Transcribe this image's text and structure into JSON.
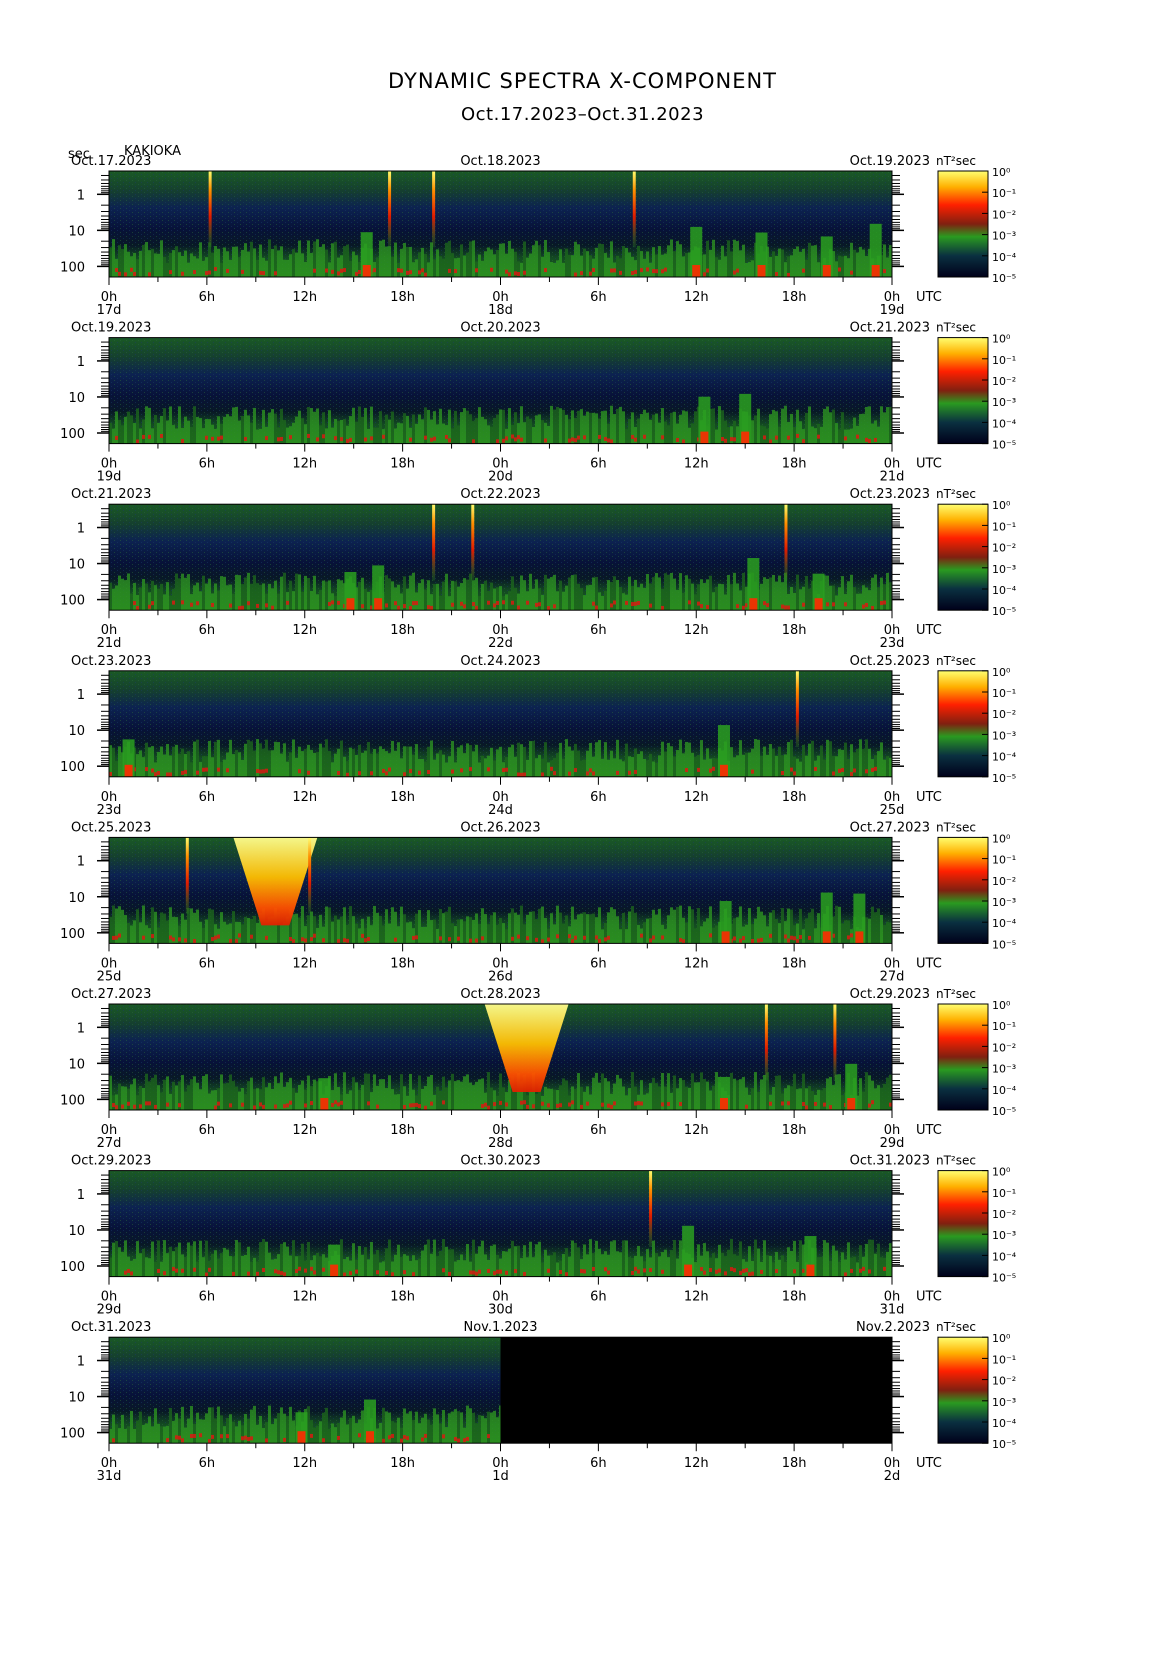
{
  "title": "DYNAMIC SPECTRA X-COMPONENT",
  "subtitle": "Oct.17.2023–Oct.31.2023",
  "station": "KAKIOKA",
  "y_unit": "sec",
  "colorbar_unit": "nT²sec",
  "utc_label": "UTC",
  "colors": {
    "background": "#ffffff",
    "no_data": "#000000"
  },
  "chart_data": {
    "type": "heatmap",
    "ylabel": "sec",
    "y_ticks": [
      "1",
      "10",
      "100"
    ],
    "x_ticks": [
      "0h",
      "6h",
      "12h",
      "18h",
      "0h",
      "6h",
      "12h",
      "18h",
      "0h"
    ],
    "colorbar_ticks": [
      "10⁰",
      "10⁻¹",
      "10⁻²",
      "10⁻³",
      "10⁻⁴",
      "10⁻⁵"
    ],
    "colorbar_unit": "nT²sec",
    "colorscale": [
      "#000010",
      "#0a1a4a",
      "#1a5a2a",
      "#2aa020",
      "#e01010",
      "#ff8000",
      "#ffff60"
    ],
    "panels": [
      {
        "date_left": "Oct.17.2023",
        "date_mid": "Oct.18.2023",
        "date_right": "Oct.19.2023",
        "day_labels": [
          "17d",
          "18d",
          "19d"
        ],
        "spikes_hours": [
          6.2,
          17.2,
          19.9,
          32.2
        ],
        "storm_hours": [],
        "bursts_hours": [
          15.8,
          36,
          40,
          44,
          47
        ],
        "data_end_hour": 48
      },
      {
        "date_left": "Oct.19.2023",
        "date_mid": "Oct.20.2023",
        "date_right": "Oct.21.2023",
        "day_labels": [
          "19d",
          "20d",
          "21d"
        ],
        "spikes_hours": [],
        "storm_hours": [],
        "bursts_hours": [
          36.5,
          39
        ],
        "data_end_hour": 48
      },
      {
        "date_left": "Oct.21.2023",
        "date_mid": "Oct.22.2023",
        "date_right": "Oct.23.2023",
        "day_labels": [
          "21d",
          "22d",
          "23d"
        ],
        "spikes_hours": [
          19.9,
          22.3,
          41.5
        ],
        "storm_hours": [],
        "bursts_hours": [
          14.8,
          16.5,
          39.5,
          43.5
        ],
        "data_end_hour": 48
      },
      {
        "date_left": "Oct.23.2023",
        "date_mid": "Oct.24.2023",
        "date_right": "Oct.25.2023",
        "day_labels": [
          "23d",
          "24d",
          "25d"
        ],
        "spikes_hours": [
          42.2
        ],
        "storm_hours": [],
        "bursts_hours": [
          1.2,
          37.7
        ],
        "data_end_hour": 48
      },
      {
        "date_left": "Oct.25.2023",
        "date_mid": "Oct.26.2023",
        "date_right": "Oct.27.2023",
        "day_labels": [
          "25d",
          "26d",
          "27d"
        ],
        "spikes_hours": [
          4.8,
          12.3
        ],
        "storm_hours": [
          10.2
        ],
        "bursts_hours": [
          37.8,
          44,
          46
        ],
        "data_end_hour": 48
      },
      {
        "date_left": "Oct.27.2023",
        "date_mid": "Oct.28.2023",
        "date_right": "Oct.29.2023",
        "day_labels": [
          "27d",
          "28d",
          "29d"
        ],
        "spikes_hours": [
          40.3,
          44.5
        ],
        "storm_hours": [
          25.6
        ],
        "bursts_hours": [
          13.2,
          37.7,
          45.5
        ],
        "data_end_hour": 48
      },
      {
        "date_left": "Oct.29.2023",
        "date_mid": "Oct.30.2023",
        "date_right": "Oct.31.2023",
        "day_labels": [
          "29d",
          "30d",
          "31d"
        ],
        "spikes_hours": [
          33.2
        ],
        "storm_hours": [],
        "bursts_hours": [
          13.8,
          35.5,
          43
        ],
        "data_end_hour": 48
      },
      {
        "date_left": "Oct.31.2023",
        "date_mid": "Nov.1.2023",
        "date_right": "Nov.2.2023",
        "day_labels": [
          "31d",
          "1d",
          "2d"
        ],
        "spikes_hours": [],
        "storm_hours": [],
        "bursts_hours": [
          11.8,
          16
        ],
        "data_end_hour": 24
      }
    ]
  }
}
